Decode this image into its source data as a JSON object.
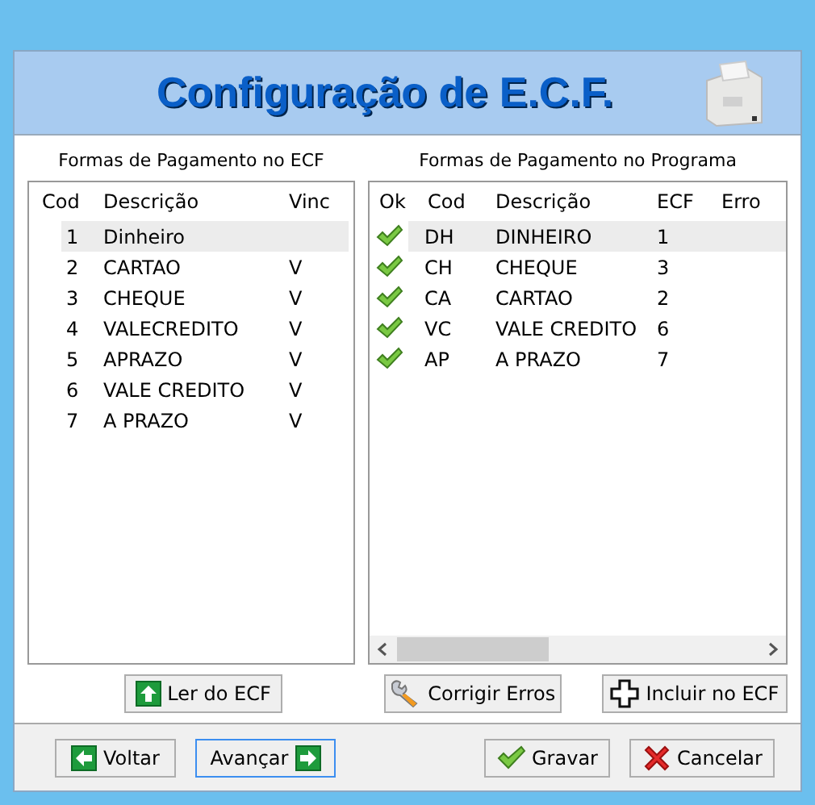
{
  "header": {
    "title": "Configuração de E.C.F."
  },
  "ecf_panel": {
    "title": "Formas de Pagamento no ECF",
    "columns": [
      "Cod",
      "Descrição",
      "Vinc"
    ],
    "rows": [
      {
        "cells": [
          "1",
          "Dinheiro",
          ""
        ],
        "selected": true
      },
      {
        "cells": [
          "2",
          "CARTAO",
          "V"
        ],
        "selected": false
      },
      {
        "cells": [
          "3",
          "CHEQUE",
          "V"
        ],
        "selected": false
      },
      {
        "cells": [
          "4",
          "VALECREDITO",
          "V"
        ],
        "selected": false
      },
      {
        "cells": [
          "5",
          "APRAZO",
          "V"
        ],
        "selected": false
      },
      {
        "cells": [
          "6",
          "VALE CREDITO",
          "V"
        ],
        "selected": false
      },
      {
        "cells": [
          "7",
          "A PRAZO",
          "V"
        ],
        "selected": false
      }
    ]
  },
  "program_panel": {
    "title": "Formas de Pagamento no Programa",
    "columns": [
      "Ok",
      "Cod",
      "Descrição",
      "ECF",
      "Erro"
    ],
    "rows": [
      {
        "ok": true,
        "cells": [
          "",
          "DH",
          "DINHEIRO",
          "1"
        ],
        "selected": true
      },
      {
        "ok": true,
        "cells": [
          "",
          "CH",
          "CHEQUE",
          "3"
        ],
        "selected": false
      },
      {
        "ok": true,
        "cells": [
          "",
          "CA",
          "CARTAO",
          "2"
        ],
        "selected": false
      },
      {
        "ok": true,
        "cells": [
          "",
          "VC",
          "VALE CREDITO",
          "6"
        ],
        "selected": false
      },
      {
        "ok": true,
        "cells": [
          "",
          "AP",
          "A PRAZO",
          "7"
        ],
        "selected": false
      }
    ]
  },
  "action_buttons": [
    {
      "label": "Ler do ECF",
      "kind": "up"
    },
    {
      "label": "Corrigir Erros",
      "kind": "wrench"
    },
    {
      "label": "Incluir no ECF",
      "kind": "plus"
    }
  ],
  "footer_buttons": [
    {
      "label": "Voltar",
      "kind": "back",
      "focused": false
    },
    {
      "label": "Avançar",
      "kind": "next",
      "focused": true
    },
    {
      "label": "Gravar",
      "kind": "check",
      "focused": false
    },
    {
      "label": "Cancelar",
      "kind": "cancel",
      "focused": false
    }
  ]
}
